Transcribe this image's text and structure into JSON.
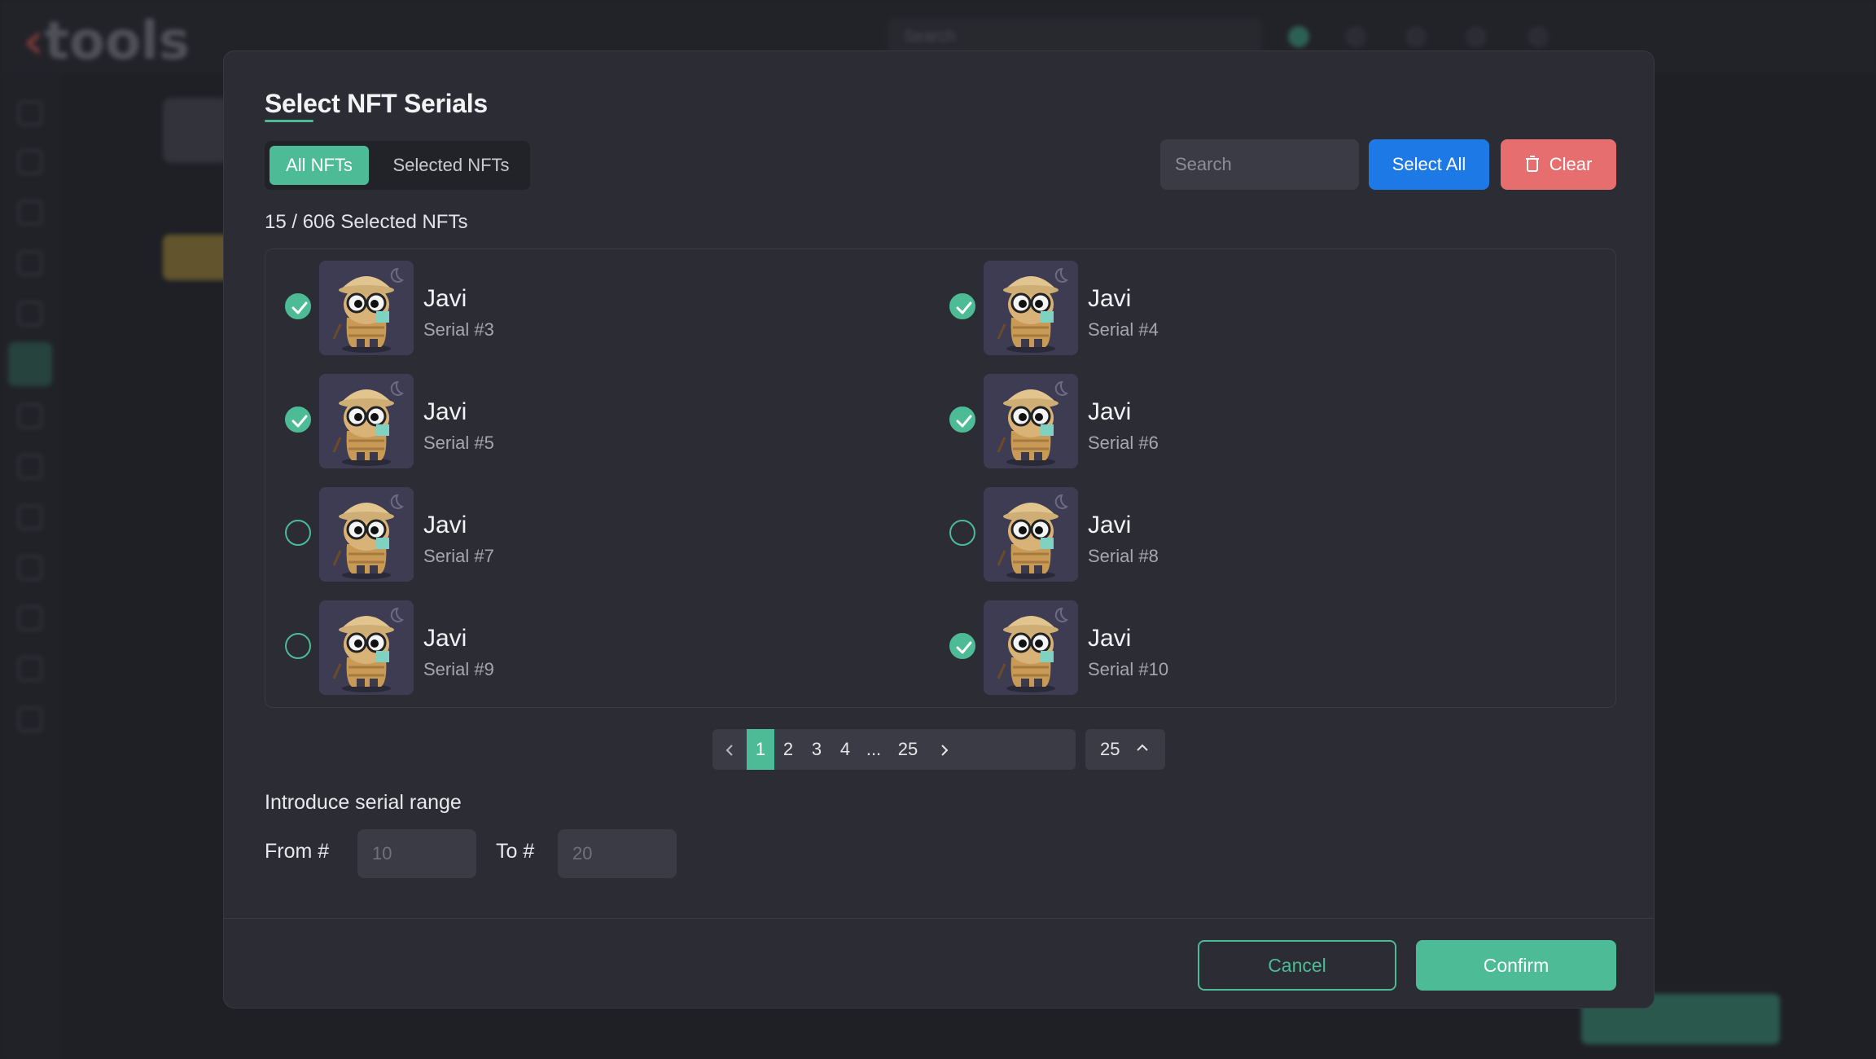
{
  "background": {
    "logo_text": "tools",
    "search_placeholder": "Search"
  },
  "modal": {
    "title": "Select NFT Serials",
    "tabs": [
      {
        "label": "All NFTs",
        "active": true
      },
      {
        "label": "Selected NFTs",
        "active": false
      }
    ],
    "search_placeholder": "Search",
    "select_all_label": "Select All",
    "clear_label": "Clear",
    "selected_count_text": "15 / 606 Selected NFTs",
    "items": [
      {
        "name": "Javi",
        "serial": "Serial #3",
        "checked": true
      },
      {
        "name": "Javi",
        "serial": "Serial #4",
        "checked": true
      },
      {
        "name": "Javi",
        "serial": "Serial #5",
        "checked": true
      },
      {
        "name": "Javi",
        "serial": "Serial #6",
        "checked": true
      },
      {
        "name": "Javi",
        "serial": "Serial #7",
        "checked": false
      },
      {
        "name": "Javi",
        "serial": "Serial #8",
        "checked": false
      },
      {
        "name": "Javi",
        "serial": "Serial #9",
        "checked": false
      },
      {
        "name": "Javi",
        "serial": "Serial #10",
        "checked": true
      }
    ],
    "pagination": {
      "prev_icon": "chevron-left-icon",
      "pages": [
        "1",
        "2",
        "3",
        "4",
        "...",
        "25"
      ],
      "current_page": "1",
      "next_icon": "chevron-right-icon",
      "per_page": "25"
    },
    "range": {
      "title": "Introduce serial range",
      "from_label": "From #",
      "from_placeholder": "10",
      "to_label": "To #",
      "to_placeholder": "20"
    },
    "cancel_label": "Cancel",
    "confirm_label": "Confirm"
  },
  "colors": {
    "accent": "#4dbb95",
    "primary_blue": "#1c79e6",
    "danger": "#e66e6e",
    "modal_bg": "#2b2c34"
  }
}
